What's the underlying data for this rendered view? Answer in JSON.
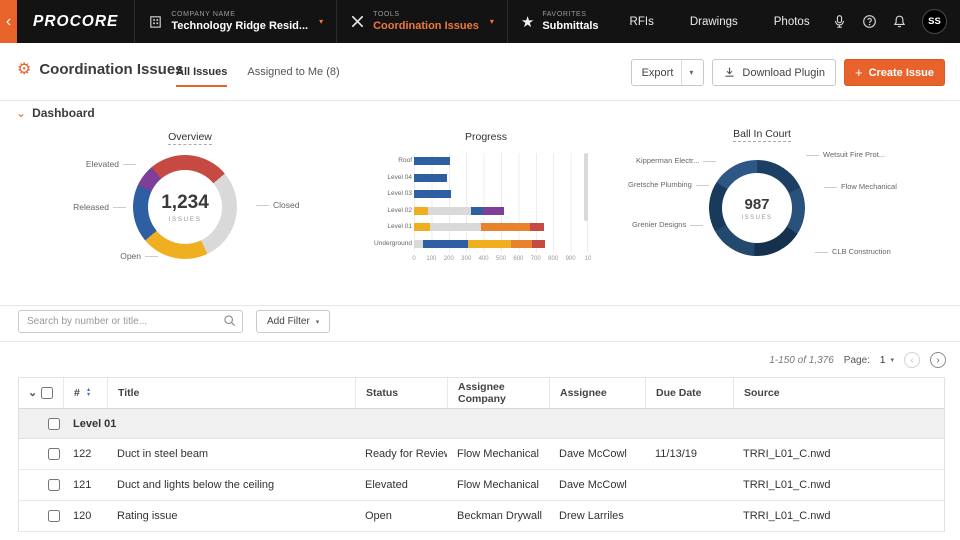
{
  "icons": {
    "back": "‹",
    "caret": "▾",
    "star": "★",
    "gear": "⚙",
    "plus": "+",
    "chevron_down": "⌄",
    "sort_asc": "▲",
    "sort_desc": "▼",
    "prev": "‹",
    "next": "›"
  },
  "colors": {
    "accent": "#e8622b",
    "navy": "#1d3f63"
  },
  "nav": {
    "logo": "PROCORE",
    "company": {
      "label": "COMPANY NAME",
      "value": "Technology Ridge Resid..."
    },
    "tools": {
      "label": "TOOLS",
      "value": "Coordination Issues"
    },
    "favorites": {
      "label": "FAVORITES",
      "value": "Submittals"
    },
    "links": [
      "RFIs",
      "Drawings",
      "Photos"
    ],
    "avatar": "SS"
  },
  "header": {
    "title": "Coordination Issues",
    "tabs": [
      {
        "label": "All Issues"
      },
      {
        "label": "Assigned to Me (8)"
      }
    ],
    "export_label": "Export",
    "download_label": "Download Plugin",
    "create_label": "Create Issue"
  },
  "dashboard": {
    "title": "Dashboard"
  },
  "chart_data": [
    {
      "id": "overview",
      "type": "donut",
      "title": "Overview",
      "center_value": "1,234",
      "center_label": "ISSUES",
      "start_angle": "-40deg",
      "segments": [
        {
          "label": "Elevated",
          "color": "#c74a42",
          "pct": 25
        },
        {
          "label": "Closed",
          "color": "#d9d9d9",
          "pct": 29
        },
        {
          "label": "Open",
          "color": "#efaf20",
          "pct": 21
        },
        {
          "label": "Released",
          "color": "#2e5fa3",
          "pct": 18
        },
        {
          "label": "",
          "color": "#7d3f98",
          "pct": 7
        }
      ]
    },
    {
      "id": "progress",
      "type": "stacked_bar_horizontal",
      "title": "Progress",
      "categories": [
        "Roof",
        "Level 04",
        "Level 03",
        "Level 02",
        "Level 01",
        "Underground"
      ],
      "xlim": [
        0,
        1000
      ],
      "xtick_labels": [
        "0",
        "100",
        "200",
        "300",
        "400",
        "500",
        "600",
        "700",
        "800",
        "900",
        "10"
      ],
      "rows": [
        [
          {
            "c": "#2e5fa3",
            "v": 210
          }
        ],
        [
          {
            "c": "#2e5fa3",
            "v": 190
          }
        ],
        [
          {
            "c": "#2e5fa3",
            "v": 215
          }
        ],
        [
          {
            "c": "#efaf20",
            "v": 80
          },
          {
            "c": "#d9d9d9",
            "v": 250
          },
          {
            "c": "#2e5fa3",
            "v": 70
          },
          {
            "c": "#7d3f98",
            "v": 120
          }
        ],
        [
          {
            "c": "#efaf20",
            "v": 90
          },
          {
            "c": "#d9d9d9",
            "v": 300
          },
          {
            "c": "#e8832b",
            "v": 280
          },
          {
            "c": "#c74a42",
            "v": 80
          }
        ],
        [
          {
            "c": "#d9d9d9",
            "v": 50
          },
          {
            "c": "#2e5fa3",
            "v": 260
          },
          {
            "c": "#efaf20",
            "v": 250
          },
          {
            "c": "#e8832b",
            "v": 120
          },
          {
            "c": "#c74a42",
            "v": 80
          }
        ]
      ]
    },
    {
      "id": "ball_in_court",
      "type": "donut",
      "title": "Ball In Court",
      "center_value": "987",
      "center_label": "ISSUES",
      "start_angle": "0deg",
      "segments": [
        {
          "label": "Wetsuit Fire Prot...",
          "color": "#1d3f63",
          "pct": 18
        },
        {
          "label": "Flow Mechanical",
          "color": "#2a517c",
          "pct": 16
        },
        {
          "label": "CLB Construction",
          "color": "#16314e",
          "pct": 17
        },
        {
          "label": "Grenier Designs",
          "color": "#24496f",
          "pct": 16
        },
        {
          "label": "Gretsche Plumbing",
          "color": "#1a3a5c",
          "pct": 17
        },
        {
          "label": "Kipperman Electr...",
          "color": "#2d5784",
          "pct": 16
        }
      ]
    }
  ],
  "filters": {
    "search_placeholder": "Search by number or title...",
    "add_filter_label": "Add Filter"
  },
  "pagination": {
    "range": "1-150 of 1,376",
    "page_label": "Page:",
    "page": "1"
  },
  "table": {
    "columns": [
      "#",
      "Title",
      "Status",
      "Assignee Company",
      "Assignee",
      "Due Date",
      "Source"
    ],
    "group_label": "Level 01",
    "rows": [
      {
        "number": "122",
        "title": "Duct in steel beam",
        "status": "Ready for Review",
        "company": "Flow Mechanical",
        "assignee": "Dave McCowl",
        "due": "11/13/19",
        "source": "TRRI_L01_C.nwd"
      },
      {
        "number": "121",
        "title": "Duct and lights below the ceiling",
        "status": "Elevated",
        "company": "Flow Mechanical",
        "assignee": "Dave McCowl",
        "due": "",
        "source": "TRRI_L01_C.nwd"
      },
      {
        "number": "120",
        "title": "Rating issue",
        "status": "Open",
        "company": "Beckman Drywall",
        "assignee": "Drew Larriles",
        "due": "",
        "source": "TRRI_L01_C.nwd"
      }
    ]
  }
}
